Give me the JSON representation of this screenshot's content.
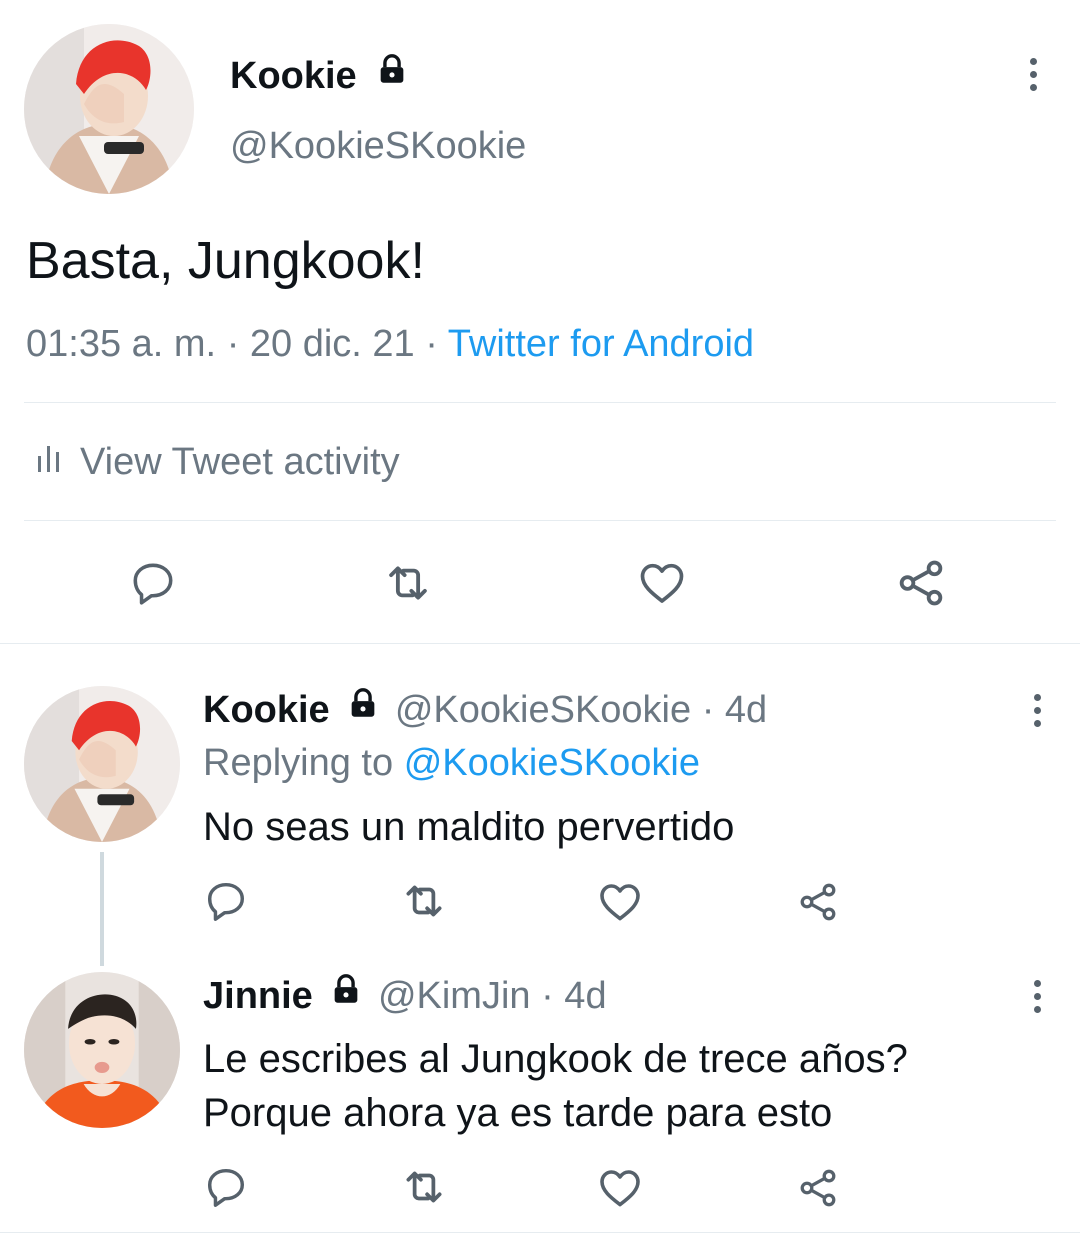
{
  "main_tweet": {
    "name": "Kookie",
    "handle": "@KookieSKookie",
    "text": "Basta, Jungkook!",
    "time": "01:35 a. m.",
    "date": "20 dic. 21",
    "separator": "·",
    "source": "Twitter for Android",
    "activity_label": "View Tweet activity"
  },
  "replies": [
    {
      "name": "Kookie",
      "handle": "@KookieSKookie",
      "age": "· 4d",
      "replying_prefix": "Replying to",
      "replying_to": "@KookieSKookie",
      "text": "No seas un maldito pervertido"
    },
    {
      "name": "Jinnie",
      "handle": "@KimJin",
      "age": "· 4d",
      "text_line1": "Le escribes al Jungkook de trece años?",
      "text_line2": "Porque ahora ya es tarde para esto"
    }
  ],
  "icons": {
    "reply": "reply-icon",
    "retweet": "retweet-icon",
    "like": "like-icon",
    "share": "share-icon",
    "lock": "lock-icon",
    "more": "more-icon",
    "activity": "bar-chart-icon"
  },
  "colors": {
    "link": "#1d9bf0",
    "muted": "#6b7782",
    "text": "#0f1419",
    "avatar1_hair": "#e8342c",
    "avatar2_shirt": "#f25a1e"
  }
}
